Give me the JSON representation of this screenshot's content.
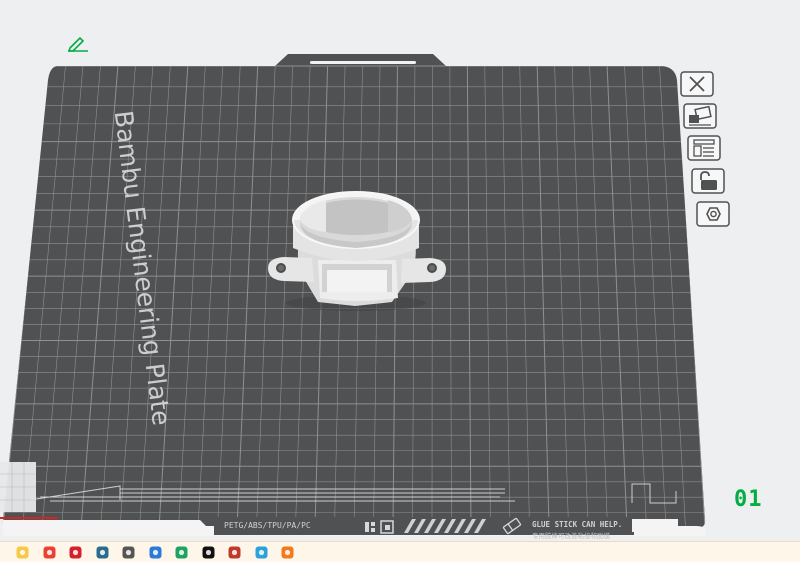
{
  "plate": {
    "label": "Bambu Engineering Plate",
    "filament_types": "PETG/ABS/TPU/PA/PC",
    "glue_notice": "GLUE STICK CAN HELP.",
    "glue_notice_cn": "专用胶棒可改善粘接和脱模",
    "index": "01"
  },
  "plate_tools": [
    {
      "name": "close-plate-button",
      "icon": "close-icon"
    },
    {
      "name": "arrange-button",
      "icon": "arrange-icon"
    },
    {
      "name": "plate-settings-button",
      "icon": "layout-icon"
    },
    {
      "name": "lock-plate-button",
      "icon": "unlock-icon"
    },
    {
      "name": "plate-filament-button",
      "icon": "hexagon-nut-icon"
    }
  ],
  "colors": {
    "plate": "#4f5152",
    "grid": "#9a9c9d",
    "accent": "#00ae42",
    "background": "#eeeff0",
    "model": "#e2e2e2"
  },
  "taskbar": {
    "apps": [
      {
        "name": "file-explorer-icon",
        "color": "#f7c948"
      },
      {
        "name": "chrome-icon",
        "color": "#e94235"
      },
      {
        "name": "opera-icon",
        "color": "#d51f2b"
      },
      {
        "name": "bambu-studio-icon",
        "color": "#2a6c8e"
      },
      {
        "name": "app-icon",
        "color": "#555555"
      },
      {
        "name": "mail-icon",
        "color": "#2b7bd6"
      },
      {
        "name": "sheets-icon",
        "color": "#1ea362"
      },
      {
        "name": "tiktok-icon",
        "color": "#111111"
      },
      {
        "name": "record-icon",
        "color": "#c0392b"
      },
      {
        "name": "telegram-icon",
        "color": "#2aa3d8"
      },
      {
        "name": "orange-app-icon",
        "color": "#f27a1a"
      }
    ]
  }
}
